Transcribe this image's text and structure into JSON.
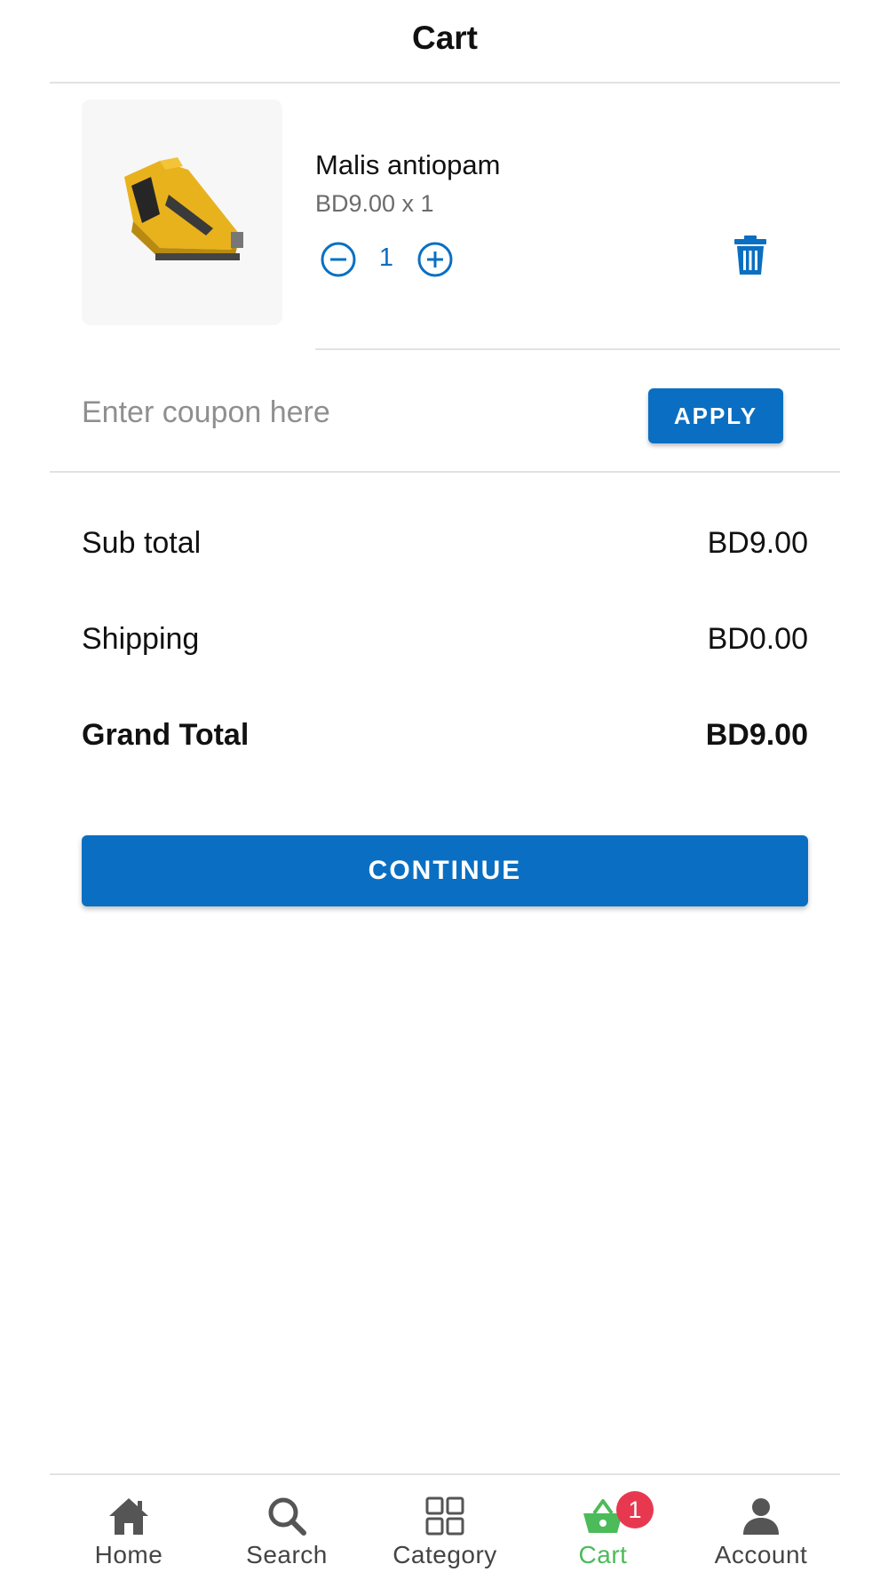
{
  "header": {
    "title": "Cart"
  },
  "cart": {
    "items": [
      {
        "name": "Malis antiopam",
        "price_line": "BD9.00 x 1",
        "quantity": "1",
        "image_icon": "stapler-product-image",
        "minus_icon": "minus-circle-icon",
        "plus_icon": "plus-circle-icon",
        "delete_icon": "trash-icon"
      }
    ]
  },
  "coupon": {
    "placeholder": "Enter coupon here",
    "value": "",
    "apply_label": "APPLY"
  },
  "totals": {
    "subtotal_label": "Sub total",
    "subtotal_value": "BD9.00",
    "shipping_label": "Shipping",
    "shipping_value": "BD0.00",
    "grand_total_label": "Grand Total",
    "grand_total_value": "BD9.00"
  },
  "continue_label": "CONTINUE",
  "bottom_nav": {
    "active": "Cart",
    "items": [
      {
        "label": "Home",
        "icon": "home-icon"
      },
      {
        "label": "Search",
        "icon": "search-icon"
      },
      {
        "label": "Category",
        "icon": "grid-icon"
      },
      {
        "label": "Cart",
        "icon": "basket-icon",
        "badge": "1"
      },
      {
        "label": "Account",
        "icon": "person-icon"
      }
    ]
  },
  "colors": {
    "primary": "#0a6fc2",
    "active_nav": "#4cbb5a",
    "badge": "#e8384f",
    "divider": "#e2e2e2"
  }
}
